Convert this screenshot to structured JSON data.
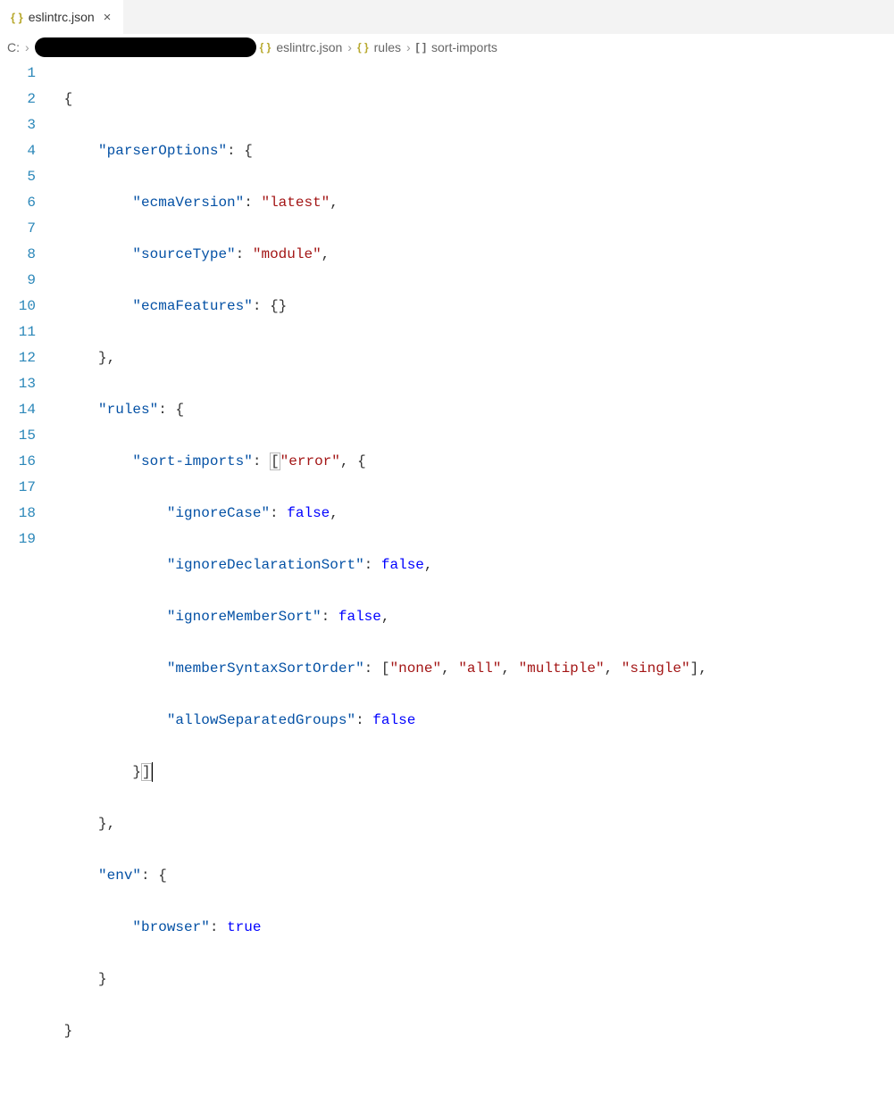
{
  "tab": {
    "icon": "{ }",
    "filename": "eslintrc.json",
    "close": "×"
  },
  "breadcrumb": {
    "drive": "C:",
    "sep": "›",
    "file_icon": "{ }",
    "filename": "eslintrc.json",
    "obj_icon": "{ }",
    "rules": "rules",
    "arr_icon": "[ ]",
    "sortimports": "sort-imports"
  },
  "lines": [
    "1",
    "2",
    "3",
    "4",
    "5",
    "6",
    "7",
    "8",
    "9",
    "10",
    "11",
    "12",
    "13",
    "14",
    "15",
    "16",
    "17",
    "18",
    "19"
  ],
  "code": {
    "parserOptions": "\"parserOptions\"",
    "ecmaVersion": "\"ecmaVersion\"",
    "latest": "\"latest\"",
    "sourceType": "\"sourceType\"",
    "module": "\"module\"",
    "ecmaFeatures": "\"ecmaFeatures\"",
    "rules": "\"rules\"",
    "sortImports": "\"sort-imports\"",
    "error": "\"error\"",
    "ignoreCase": "\"ignoreCase\"",
    "ignoreDeclarationSort": "\"ignoreDeclarationSort\"",
    "ignoreMemberSort": "\"ignoreMemberSort\"",
    "memberSyntaxSortOrder": "\"memberSyntaxSortOrder\"",
    "none": "\"none\"",
    "all": "\"all\"",
    "multiple": "\"multiple\"",
    "single": "\"single\"",
    "allowSeparatedGroups": "\"allowSeparatedGroups\"",
    "env": "\"env\"",
    "browser": "\"browser\"",
    "false": "false",
    "true": "true"
  }
}
